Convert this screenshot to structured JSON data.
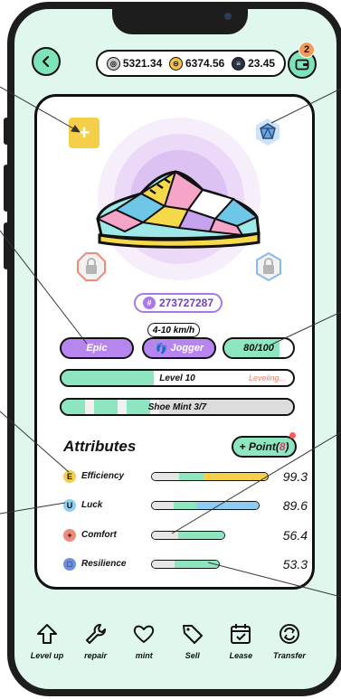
{
  "header": {
    "currencies": [
      {
        "icon": "gray-coin-icon",
        "value": "5321.34"
      },
      {
        "icon": "yellow-coin-icon",
        "value": "6374.56"
      },
      {
        "icon": "dark-coin-icon",
        "value": "23.45"
      }
    ],
    "wallet_badge": "2"
  },
  "shoe": {
    "token_id": "273727287",
    "speed_range": "4-10 km/h",
    "rarity": "Epic",
    "type": "Jogger",
    "durability": "80/100",
    "durability_fraction": 0.8,
    "level_label": "Level 10",
    "level_status": "Leveling...",
    "mint_label": "Shoe Mint 3/7"
  },
  "attributes": {
    "title": "Attributes",
    "point_prefix": "+ Point(",
    "point_value": "8",
    "point_suffix": ")",
    "items": [
      {
        "name": "Efficiency",
        "icon": "E",
        "value": "99.3",
        "color": "#f5cf4a"
      },
      {
        "name": "Luck",
        "icon": "U",
        "value": "89.6",
        "color": "#8ecdf0"
      },
      {
        "name": "Comfort",
        "icon": "+",
        "value": "56.4",
        "color": "#f08a7a"
      },
      {
        "name": "Resilience",
        "icon": "□",
        "value": "53.3",
        "color": "#6f8ee0"
      }
    ]
  },
  "nav": {
    "items": [
      {
        "label": "Level up",
        "icon": "arrow-up-icon"
      },
      {
        "label": "repair",
        "icon": "wrench-icon"
      },
      {
        "label": "mint",
        "icon": "heart-icon"
      },
      {
        "label": "Sell",
        "icon": "tag-icon"
      },
      {
        "label": "Lease",
        "icon": "calendar-icon"
      },
      {
        "label": "Transfer",
        "icon": "transfer-icon"
      }
    ]
  },
  "colors": {
    "accent_green": "#8ee6c0",
    "accent_purple": "#b686ee",
    "background_mint": "#dff7ec"
  }
}
